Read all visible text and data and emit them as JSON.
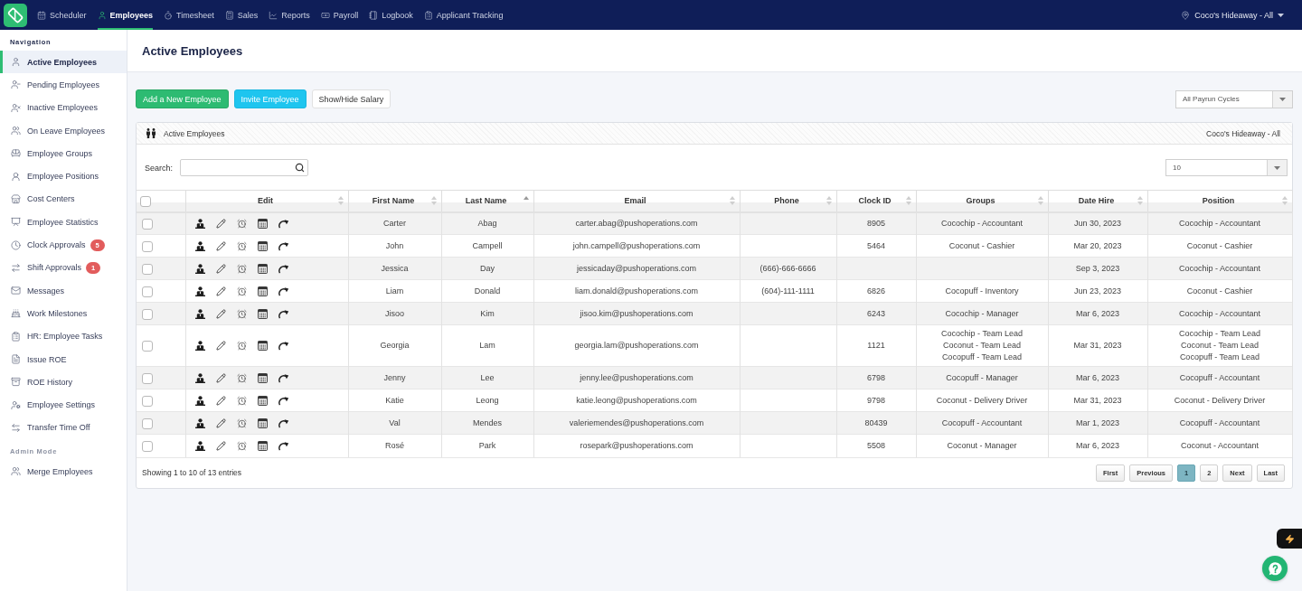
{
  "topbar": {
    "nav": [
      {
        "label": "Scheduler",
        "selected": false
      },
      {
        "label": "Employees",
        "selected": true
      },
      {
        "label": "Timesheet",
        "selected": false
      },
      {
        "label": "Sales",
        "selected": false
      },
      {
        "label": "Reports",
        "selected": false
      },
      {
        "label": "Payroll",
        "selected": false
      },
      {
        "label": "Logbook",
        "selected": false
      },
      {
        "label": "Applicant Tracking",
        "selected": false
      }
    ],
    "location": "Coco's Hideaway - All"
  },
  "sidebar": {
    "sections": [
      {
        "heading": "Navigation",
        "muted": false,
        "items": [
          {
            "label": "Active Employees",
            "selected": true
          },
          {
            "label": "Pending Employees",
            "selected": false
          },
          {
            "label": "Inactive Employees",
            "selected": false
          },
          {
            "label": "On Leave Employees",
            "selected": false
          },
          {
            "label": "Employee Groups",
            "selected": false
          },
          {
            "label": "Employee Positions",
            "selected": false
          },
          {
            "label": "Cost Centers",
            "selected": false
          },
          {
            "label": "Employee Statistics",
            "selected": false
          },
          {
            "label": "Clock Approvals",
            "selected": false,
            "badge": "5"
          },
          {
            "label": "Shift Approvals",
            "selected": false,
            "badge": "1"
          },
          {
            "label": "Messages",
            "selected": false
          },
          {
            "label": "Work Milestones",
            "selected": false
          },
          {
            "label": "HR: Employee Tasks",
            "selected": false
          },
          {
            "label": "Issue ROE",
            "selected": false
          },
          {
            "label": "ROE History",
            "selected": false
          },
          {
            "label": "Employee Settings",
            "selected": false
          },
          {
            "label": "Transfer Time Off",
            "selected": false
          }
        ]
      },
      {
        "heading": "Admin Mode",
        "muted": true,
        "items": [
          {
            "label": "Merge Employees",
            "selected": false
          }
        ]
      }
    ]
  },
  "page": {
    "title": "Active Employees"
  },
  "actions": [
    {
      "label": "Add a New Employee",
      "kind": "success"
    },
    {
      "label": "Invite Employee",
      "kind": "info"
    },
    {
      "label": "Show/Hide Salary",
      "kind": "default"
    }
  ],
  "payrun_filter": {
    "value": "All Payrun Cycles"
  },
  "panel": {
    "title": "Active Employees",
    "location": "Coco's Hideaway - All"
  },
  "search": {
    "label": "Search:"
  },
  "page_length": {
    "value": "10"
  },
  "table": {
    "select_all": {
      "checked": false
    },
    "columns": [
      {
        "label": "Edit",
        "sorted": false
      },
      {
        "label": "First Name",
        "sorted": false
      },
      {
        "label": "Last Name",
        "sorted": true
      },
      {
        "label": "Email",
        "sorted": false
      },
      {
        "label": "Phone",
        "sorted": false
      },
      {
        "label": "Clock ID",
        "sorted": false
      },
      {
        "label": "Groups",
        "sorted": false
      },
      {
        "label": "Date Hire",
        "sorted": false
      },
      {
        "label": "Position",
        "sorted": false
      }
    ],
    "rows": [
      {
        "checked": false,
        "first_name": "Carter",
        "last_name": "Abag",
        "email": "carter.abag@pushoperations.com",
        "clock_id": "8905",
        "groups": [
          "Cocochip - Accountant"
        ],
        "date_hire": "Jun 30, 2023",
        "position": [
          "Cocochip - Accountant"
        ]
      },
      {
        "checked": false,
        "first_name": "John",
        "last_name": "Campell",
        "email": "john.campell@pushoperations.com",
        "clock_id": "5464",
        "groups": [
          "Coconut - Cashier"
        ],
        "date_hire": "Mar 20, 2023",
        "position": [
          "Coconut - Cashier"
        ]
      },
      {
        "checked": false,
        "first_name": "Jessica",
        "last_name": "Day",
        "email": "jessicaday@pushoperations.com",
        "phone": "(666)-666-6666",
        "date_hire": "Sep 3, 2023",
        "position": [
          "Cocochip - Accountant"
        ]
      },
      {
        "checked": false,
        "first_name": "Liam",
        "last_name": "Donald",
        "email": "liam.donald@pushoperations.com",
        "phone": "(604)-111-1111",
        "clock_id": "6826",
        "groups": [
          "Cocopuff - Inventory"
        ],
        "date_hire": "Jun 23, 2023",
        "position": [
          "Coconut - Cashier"
        ]
      },
      {
        "checked": false,
        "first_name": "Jisoo",
        "last_name": "Kim",
        "email": "jisoo.kim@pushoperations.com",
        "clock_id": "6243",
        "groups": [
          "Cocochip - Manager"
        ],
        "date_hire": "Mar 6, 2023",
        "position": [
          "Cocochip - Accountant"
        ]
      },
      {
        "checked": false,
        "first_name": "Georgia",
        "last_name": "Lam",
        "email": "georgia.lam@pushoperations.com",
        "clock_id": "1121",
        "groups": [
          "Cocochip - Team Lead",
          "Coconut - Team Lead",
          "Cocopuff - Team Lead"
        ],
        "date_hire": "Mar 31, 2023",
        "position": [
          "Cocochip - Team Lead",
          "Coconut - Team Lead",
          "Cocopuff - Team Lead"
        ]
      },
      {
        "checked": false,
        "first_name": "Jenny",
        "last_name": "Lee",
        "email": "jenny.lee@pushoperations.com",
        "clock_id": "6798",
        "groups": [
          "Cocopuff - Manager"
        ],
        "date_hire": "Mar 6, 2023",
        "position": [
          "Cocopuff - Accountant"
        ]
      },
      {
        "checked": false,
        "first_name": "Katie",
        "last_name": "Leong",
        "email": "katie.leong@pushoperations.com",
        "clock_id": "9798",
        "groups": [
          "Coconut - Delivery Driver"
        ],
        "date_hire": "Mar 31, 2023",
        "position": [
          "Coconut - Delivery Driver"
        ]
      },
      {
        "checked": false,
        "first_name": "Val",
        "last_name": "Mendes",
        "email": "valeriemendes@pushoperations.com",
        "clock_id": "80439",
        "groups": [
          "Cocopuff - Accountant"
        ],
        "date_hire": "Mar 1, 2023",
        "position": [
          "Cocopuff - Accountant"
        ]
      },
      {
        "checked": false,
        "first_name": "Rosé",
        "last_name": "Park",
        "email": "rosepark@pushoperations.com",
        "clock_id": "5508",
        "groups": [
          "Coconut - Manager"
        ],
        "date_hire": "Mar 6, 2023",
        "position": [
          "Coconut - Accountant"
        ]
      }
    ]
  },
  "footer": {
    "info": "Showing 1 to 10 of 13 entries",
    "pages": [
      {
        "label": "First",
        "selected": false
      },
      {
        "label": "Previous",
        "selected": false
      },
      {
        "label": "1",
        "selected": true
      },
      {
        "label": "2",
        "selected": false
      },
      {
        "label": "Next",
        "selected": false
      },
      {
        "label": "Last",
        "selected": false
      }
    ]
  }
}
